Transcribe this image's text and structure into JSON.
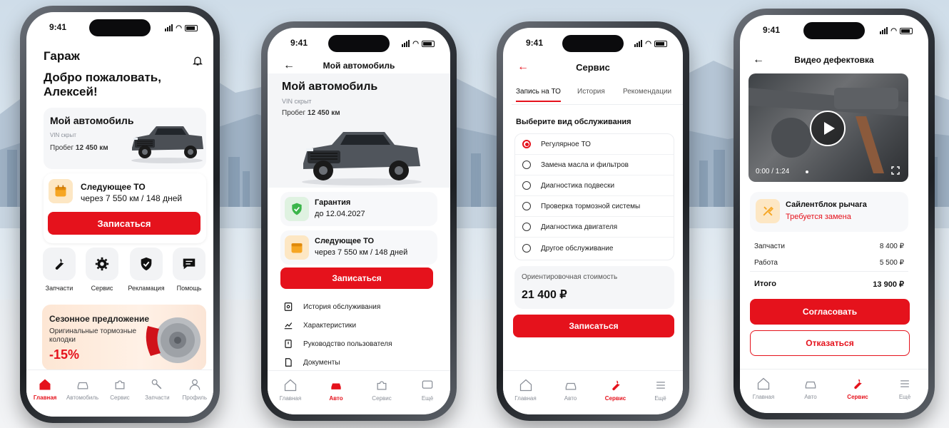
{
  "status_time": "9:41",
  "colors": {
    "accent": "#e5121c",
    "warning": "#f6a623",
    "success": "#3bb54a"
  },
  "screen1": {
    "title": "Гараж",
    "greeting_line1": "Добро пожаловать,",
    "greeting_line2": "Алексей!",
    "car_card": {
      "title": "Мой автомобиль",
      "vin": "VIN скрыт",
      "mileage_label": "Пробег",
      "mileage_value": "12 450 км"
    },
    "next_service": {
      "title": "Следующее ТО",
      "detail": "через 7 550 км / 148 дней",
      "button": "Записаться"
    },
    "quick_actions": [
      {
        "icon": "wrench-icon",
        "label": "Запчасти"
      },
      {
        "icon": "gear-icon",
        "label": "Сервис"
      },
      {
        "icon": "shield-check-icon",
        "label": "Рекламация"
      },
      {
        "icon": "chat-icon",
        "label": "Помощь"
      }
    ],
    "promo": {
      "title": "Сезонное предложение",
      "line1": "Оригинальные тормозные",
      "line2": "колодки",
      "discount": "-15%"
    },
    "tabs": [
      {
        "icon": "home-icon",
        "label": "Главная",
        "active": true
      },
      {
        "icon": "car-icon",
        "label": "Автомобиль",
        "active": false
      },
      {
        "icon": "puzzle-icon",
        "label": "Сервис",
        "active": false
      },
      {
        "icon": "parts-icon",
        "label": "Запчасти",
        "active": false
      },
      {
        "icon": "profile-icon",
        "label": "Профиль",
        "active": false
      }
    ]
  },
  "screen2": {
    "header": "Мой автомобиль",
    "title": "Мой автомобиль",
    "vin": "VIN скрыт",
    "mileage_label": "Пробег",
    "mileage_value": "12 450 км",
    "warranty": {
      "title": "Гарантия",
      "detail": "до 12.04.2027"
    },
    "next_service": {
      "title": "Следующее ТО",
      "detail": "через 7 550 км / 148 дней"
    },
    "button": "Записаться",
    "links": [
      {
        "icon": "history-icon",
        "label": "История обслуживания"
      },
      {
        "icon": "chart-icon",
        "label": "Характеристики"
      },
      {
        "icon": "book-icon",
        "label": "Руководство пользователя"
      },
      {
        "icon": "document-icon",
        "label": "Документы"
      }
    ],
    "tabs": [
      {
        "icon": "home-icon",
        "label": "Главная",
        "active": false
      },
      {
        "icon": "car-icon",
        "label": "Авто",
        "active": true
      },
      {
        "icon": "puzzle-icon",
        "label": "Сервис",
        "active": false
      },
      {
        "icon": "more-icon",
        "label": "Ещё",
        "active": false
      }
    ]
  },
  "screen3": {
    "header": "Сервис",
    "segments": [
      "Запись на ТО",
      "История",
      "Рекомендации"
    ],
    "section_title": "Выберите вид обслуживания",
    "options": [
      {
        "label": "Регулярное ТО",
        "selected": true
      },
      {
        "label": "Замена масла и фильтров",
        "selected": false
      },
      {
        "label": "Диагностика подвески",
        "selected": false
      },
      {
        "label": "Проверка тормозной системы",
        "selected": false
      },
      {
        "label": "Диагностика двигателя",
        "selected": false
      },
      {
        "label": "Другое обслуживание",
        "selected": false
      }
    ],
    "estimate_label": "Ориентировочная стоимость",
    "estimate_value": "21 400 ₽",
    "button": "Записаться",
    "tabs": [
      {
        "icon": "home-icon",
        "label": "Главная",
        "active": false
      },
      {
        "icon": "car-icon",
        "label": "Авто",
        "active": false
      },
      {
        "icon": "wrench-icon",
        "label": "Сервис",
        "active": true
      },
      {
        "icon": "more-icon",
        "label": "Ещё",
        "active": false
      }
    ]
  },
  "screen4": {
    "header": "Видео дефектовка",
    "video_time": "0:00 / 1:24",
    "issue": {
      "title": "Сайлентблок рычага",
      "status": "Требуется замена"
    },
    "costs": [
      {
        "label": "Запчасти",
        "value": "8 400 ₽"
      },
      {
        "label": "Работа",
        "value": "5 500 ₽"
      }
    ],
    "total_label": "Итого",
    "total_value": "13 900 ₽",
    "approve_button": "Согласовать",
    "decline_button": "Отказаться",
    "tabs": [
      {
        "icon": "home-icon",
        "label": "Главная",
        "active": false
      },
      {
        "icon": "car-icon",
        "label": "Авто",
        "active": false
      },
      {
        "icon": "wrench-icon",
        "label": "Сервис",
        "active": true
      },
      {
        "icon": "more-icon",
        "label": "Ещё",
        "active": false
      }
    ]
  }
}
